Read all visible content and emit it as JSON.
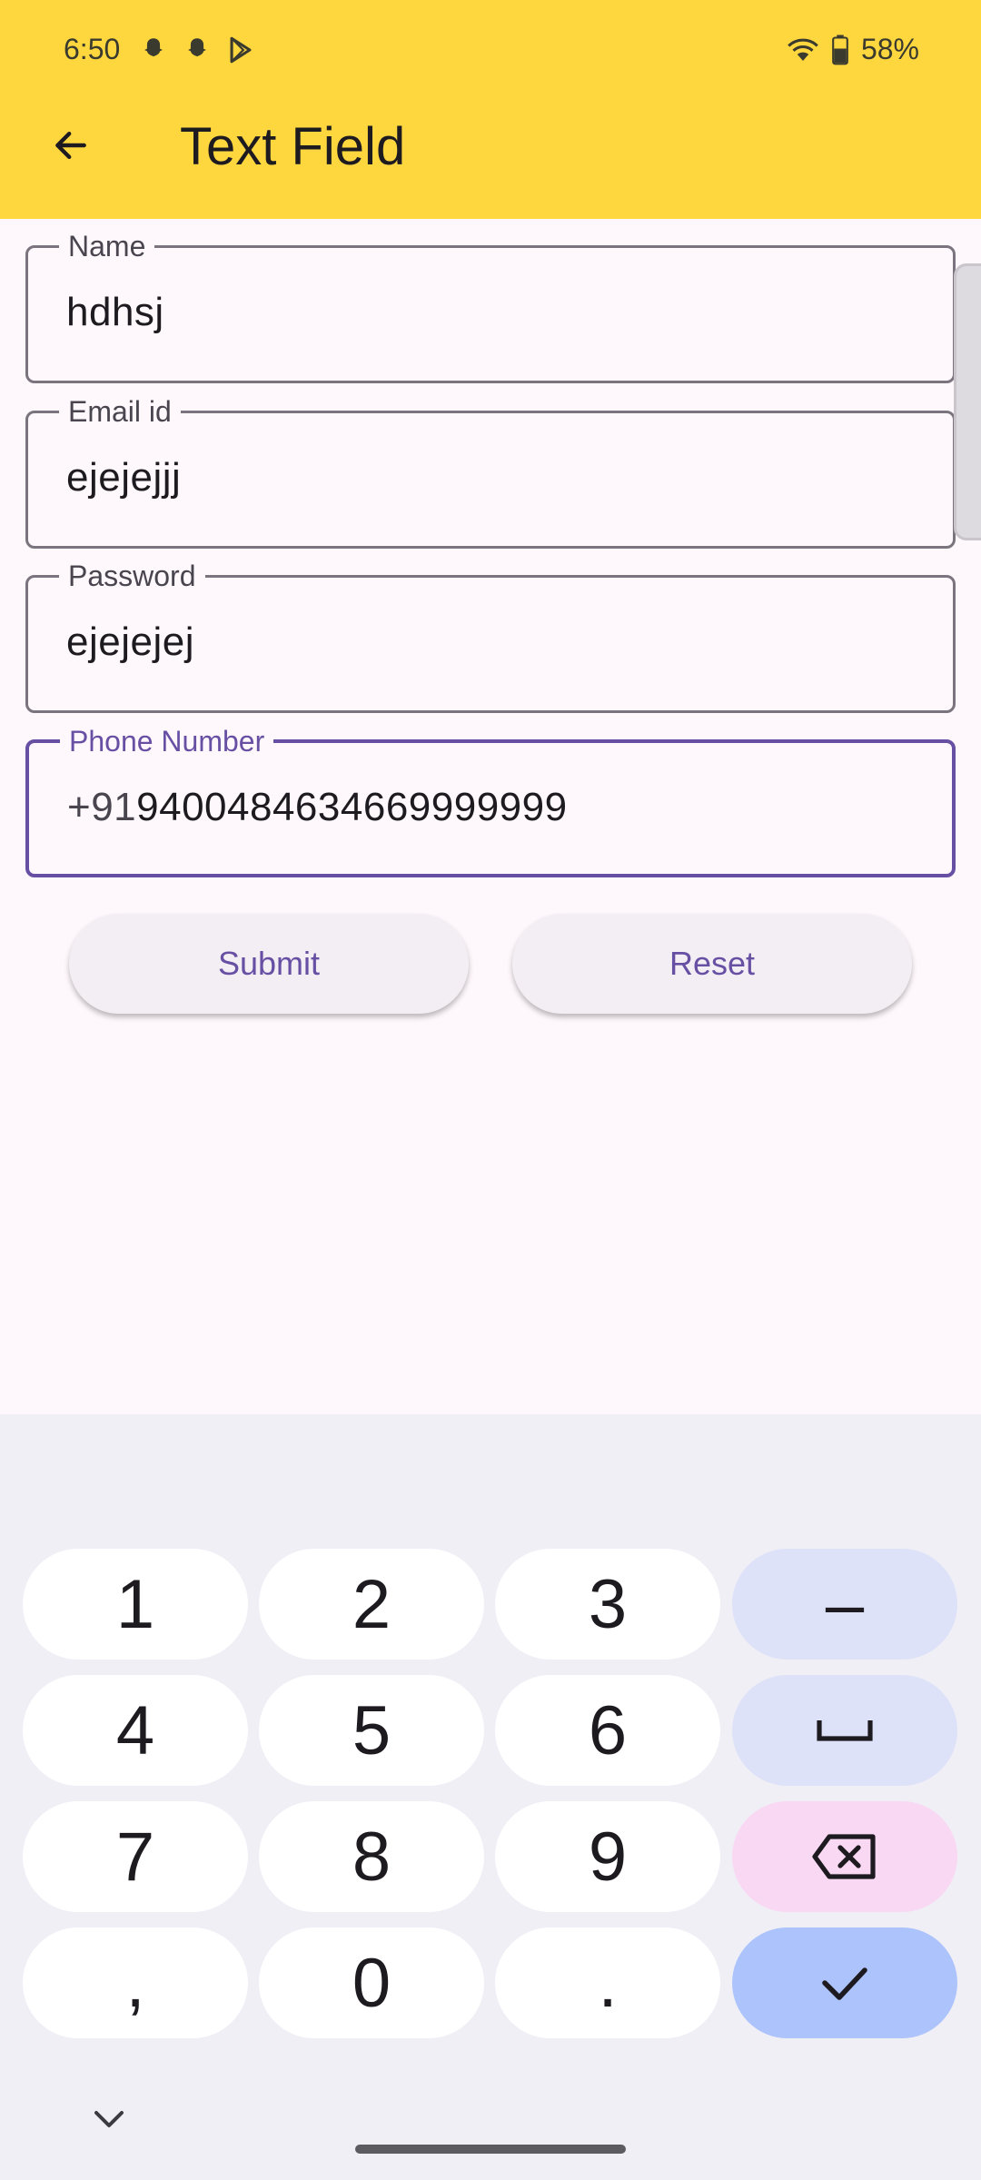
{
  "status_bar": {
    "time": "6:50",
    "battery_percent": "58%",
    "notification_icons": [
      "snapchat-icon",
      "snapchat-icon",
      "play-store-icon"
    ],
    "wifi_icon": "wifi-icon",
    "battery_icon": "battery-icon"
  },
  "app_bar": {
    "title": "Text Field",
    "back_icon": "arrow-back-icon"
  },
  "form": {
    "fields": [
      {
        "label": "Name",
        "value": "hdhsj"
      },
      {
        "label": "Email id",
        "value": "ejejejjj"
      },
      {
        "label": "Password",
        "value": "ejejejej"
      },
      {
        "label": "Phone Number",
        "prefix": "+91",
        "value": "9400484634669999999",
        "focused": true
      }
    ],
    "submit_label": "Submit",
    "reset_label": "Reset"
  },
  "keyboard": {
    "rows": [
      [
        "1",
        "2",
        "3",
        "–"
      ],
      [
        "4",
        "5",
        "6",
        "␣"
      ],
      [
        "7",
        "8",
        "9",
        "⌫"
      ],
      [
        ",",
        "0",
        ".",
        "✓"
      ]
    ],
    "collapse_icon": "chevron-down-icon"
  },
  "colors": {
    "app_bar": "#fed73f",
    "background": "#fef7fc",
    "accent": "#6750a4",
    "key_function": "#dde2f8",
    "key_delete": "#f9d8f3",
    "key_done": "#acc3fb"
  }
}
